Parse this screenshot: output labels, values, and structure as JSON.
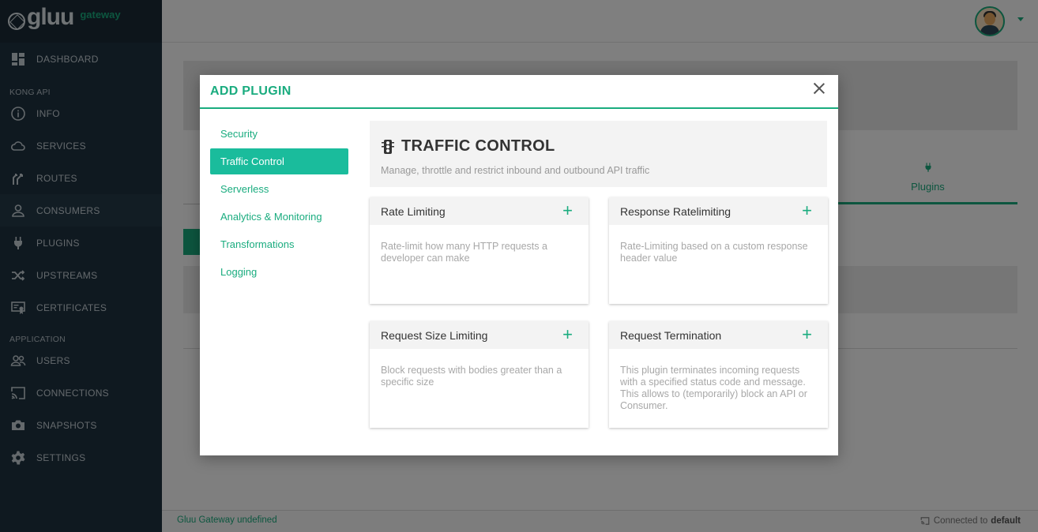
{
  "brand": {
    "logo_text": "gluu",
    "logo_sub": "gateway"
  },
  "sidebar": {
    "items": [
      {
        "label": "DASHBOARD",
        "icon": "dashboard-icon"
      },
      {
        "section": "KONG API"
      },
      {
        "label": "INFO",
        "icon": "info-icon"
      },
      {
        "label": "SERVICES",
        "icon": "cloud-icon"
      },
      {
        "label": "ROUTES",
        "icon": "routes-icon"
      },
      {
        "label": "CONSUMERS",
        "icon": "user-icon"
      },
      {
        "label": "PLUGINS",
        "icon": "plug-icon"
      },
      {
        "label": "UPSTREAMS",
        "icon": "shuffle-icon"
      },
      {
        "label": "CERTIFICATES",
        "icon": "certificate-icon"
      },
      {
        "section": "APPLICATION"
      },
      {
        "label": "USERS",
        "icon": "users-icon"
      },
      {
        "label": "CONNECTIONS",
        "icon": "cast-icon"
      },
      {
        "label": "SNAPSHOTS",
        "icon": "camera-icon"
      },
      {
        "label": "SETTINGS",
        "icon": "gear-icon"
      }
    ]
  },
  "background": {
    "tab_plugins": "Plugins"
  },
  "footer": {
    "left": "Gluu Gateway undefined",
    "connected_prefix": "Connected to",
    "connected_name": "default"
  },
  "modal": {
    "title": "ADD PLUGIN",
    "categories": [
      "Security",
      "Traffic Control",
      "Serverless",
      "Analytics & Monitoring",
      "Transformations",
      "Logging"
    ],
    "active_category": "Traffic Control",
    "category_title": "TRAFFIC CONTROL",
    "category_desc": "Manage, throttle and restrict inbound and outbound API traffic",
    "plugins": [
      {
        "name": "Rate Limiting",
        "desc": "Rate-limit how many HTTP requests a developer can make"
      },
      {
        "name": "Response Ratelimiting",
        "desc": "Rate-Limiting based on a custom response header value"
      },
      {
        "name": "Request Size Limiting",
        "desc": "Block requests with bodies greater than a specific size"
      },
      {
        "name": "Request Termination",
        "desc": "This plugin terminates incoming requests with a specified status code and message. This allows to (temporarily) block an API or Consumer."
      }
    ],
    "add_symbol": "+"
  },
  "colors": {
    "accent": "#1aac7f",
    "active_category": "#1abc9c",
    "sidebar_bg": "#1f3240"
  }
}
